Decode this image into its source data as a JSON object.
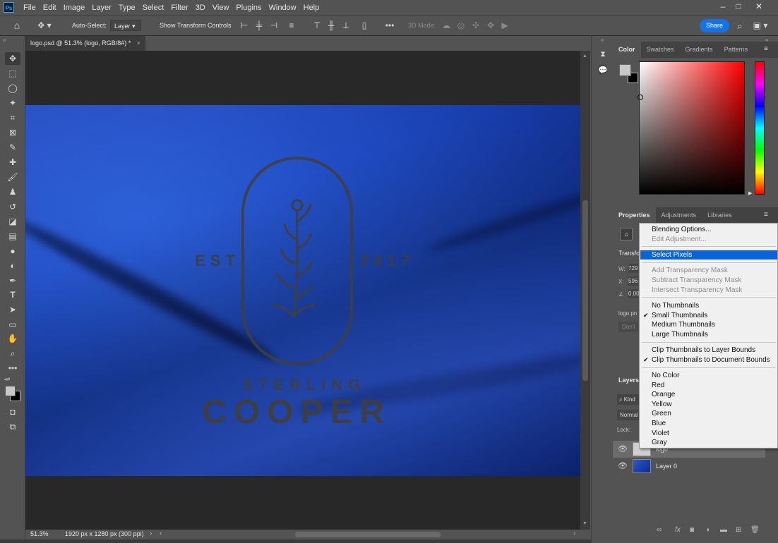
{
  "app": {
    "logo": "Ps"
  },
  "menubar": {
    "items": [
      "File",
      "Edit",
      "Image",
      "Layer",
      "Type",
      "Select",
      "Filter",
      "3D",
      "View",
      "Plugins",
      "Window",
      "Help"
    ]
  },
  "window_controls": {
    "minimize": "–",
    "maximize": "□",
    "close": "✕"
  },
  "options": {
    "auto_select_label": "Auto-Select:",
    "auto_select_value": "Layer",
    "show_transform_label": "Show Transform Controls",
    "mode_3d_label": "3D Mode:",
    "share_label": "Share",
    "more_label": "•••"
  },
  "document": {
    "tab_title": "logo.psd @ 51.3% (logo, RGB/8#) *",
    "tab_close": "×",
    "zoom": "51.3%",
    "dimensions": "1920 px x 1280 px (300 ppi)"
  },
  "artwork": {
    "est": "EST",
    "year": "2017",
    "line1": "STERLING",
    "line2": "COOPER"
  },
  "color_panel": {
    "tabs": [
      "Color",
      "Swatches",
      "Gradients",
      "Patterns"
    ]
  },
  "properties_panel": {
    "tabs": [
      "Properties",
      "Adjustments",
      "Libraries"
    ],
    "transform_label": "Transfo",
    "w_label": "W:",
    "w_value": "729",
    "x_label": "X:",
    "x_value": "596",
    "angle_value": "0.00",
    "file_label": "logo.pn",
    "dont_label": "Don't"
  },
  "layers_panel": {
    "title": "Layers",
    "kind_label": "Kind",
    "blend_mode": "Normal",
    "lock_label": "Lock:",
    "layers": [
      {
        "name": "logo"
      },
      {
        "name": "Layer 0"
      }
    ]
  },
  "context_menu": {
    "blending_options": "Blending Options...",
    "edit_adjustment": "Edit Adjustment...",
    "select_pixels": "Select Pixels",
    "add_mask": "Add Transparency Mask",
    "subtract_mask": "Subtract Transparency Mask",
    "intersect_mask": "Intersect Transparency Mask",
    "no_thumbnails": "No Thumbnails",
    "small_thumbnails": "Small Thumbnails",
    "medium_thumbnails": "Medium Thumbnails",
    "large_thumbnails": "Large Thumbnails",
    "clip_layer": "Clip Thumbnails to Layer Bounds",
    "clip_document": "Clip Thumbnails to Document Bounds",
    "no_color": "No Color",
    "red": "Red",
    "orange": "Orange",
    "yellow": "Yellow",
    "green": "Green",
    "blue": "Blue",
    "violet": "Violet",
    "gray": "Gray",
    "check": "✔"
  }
}
